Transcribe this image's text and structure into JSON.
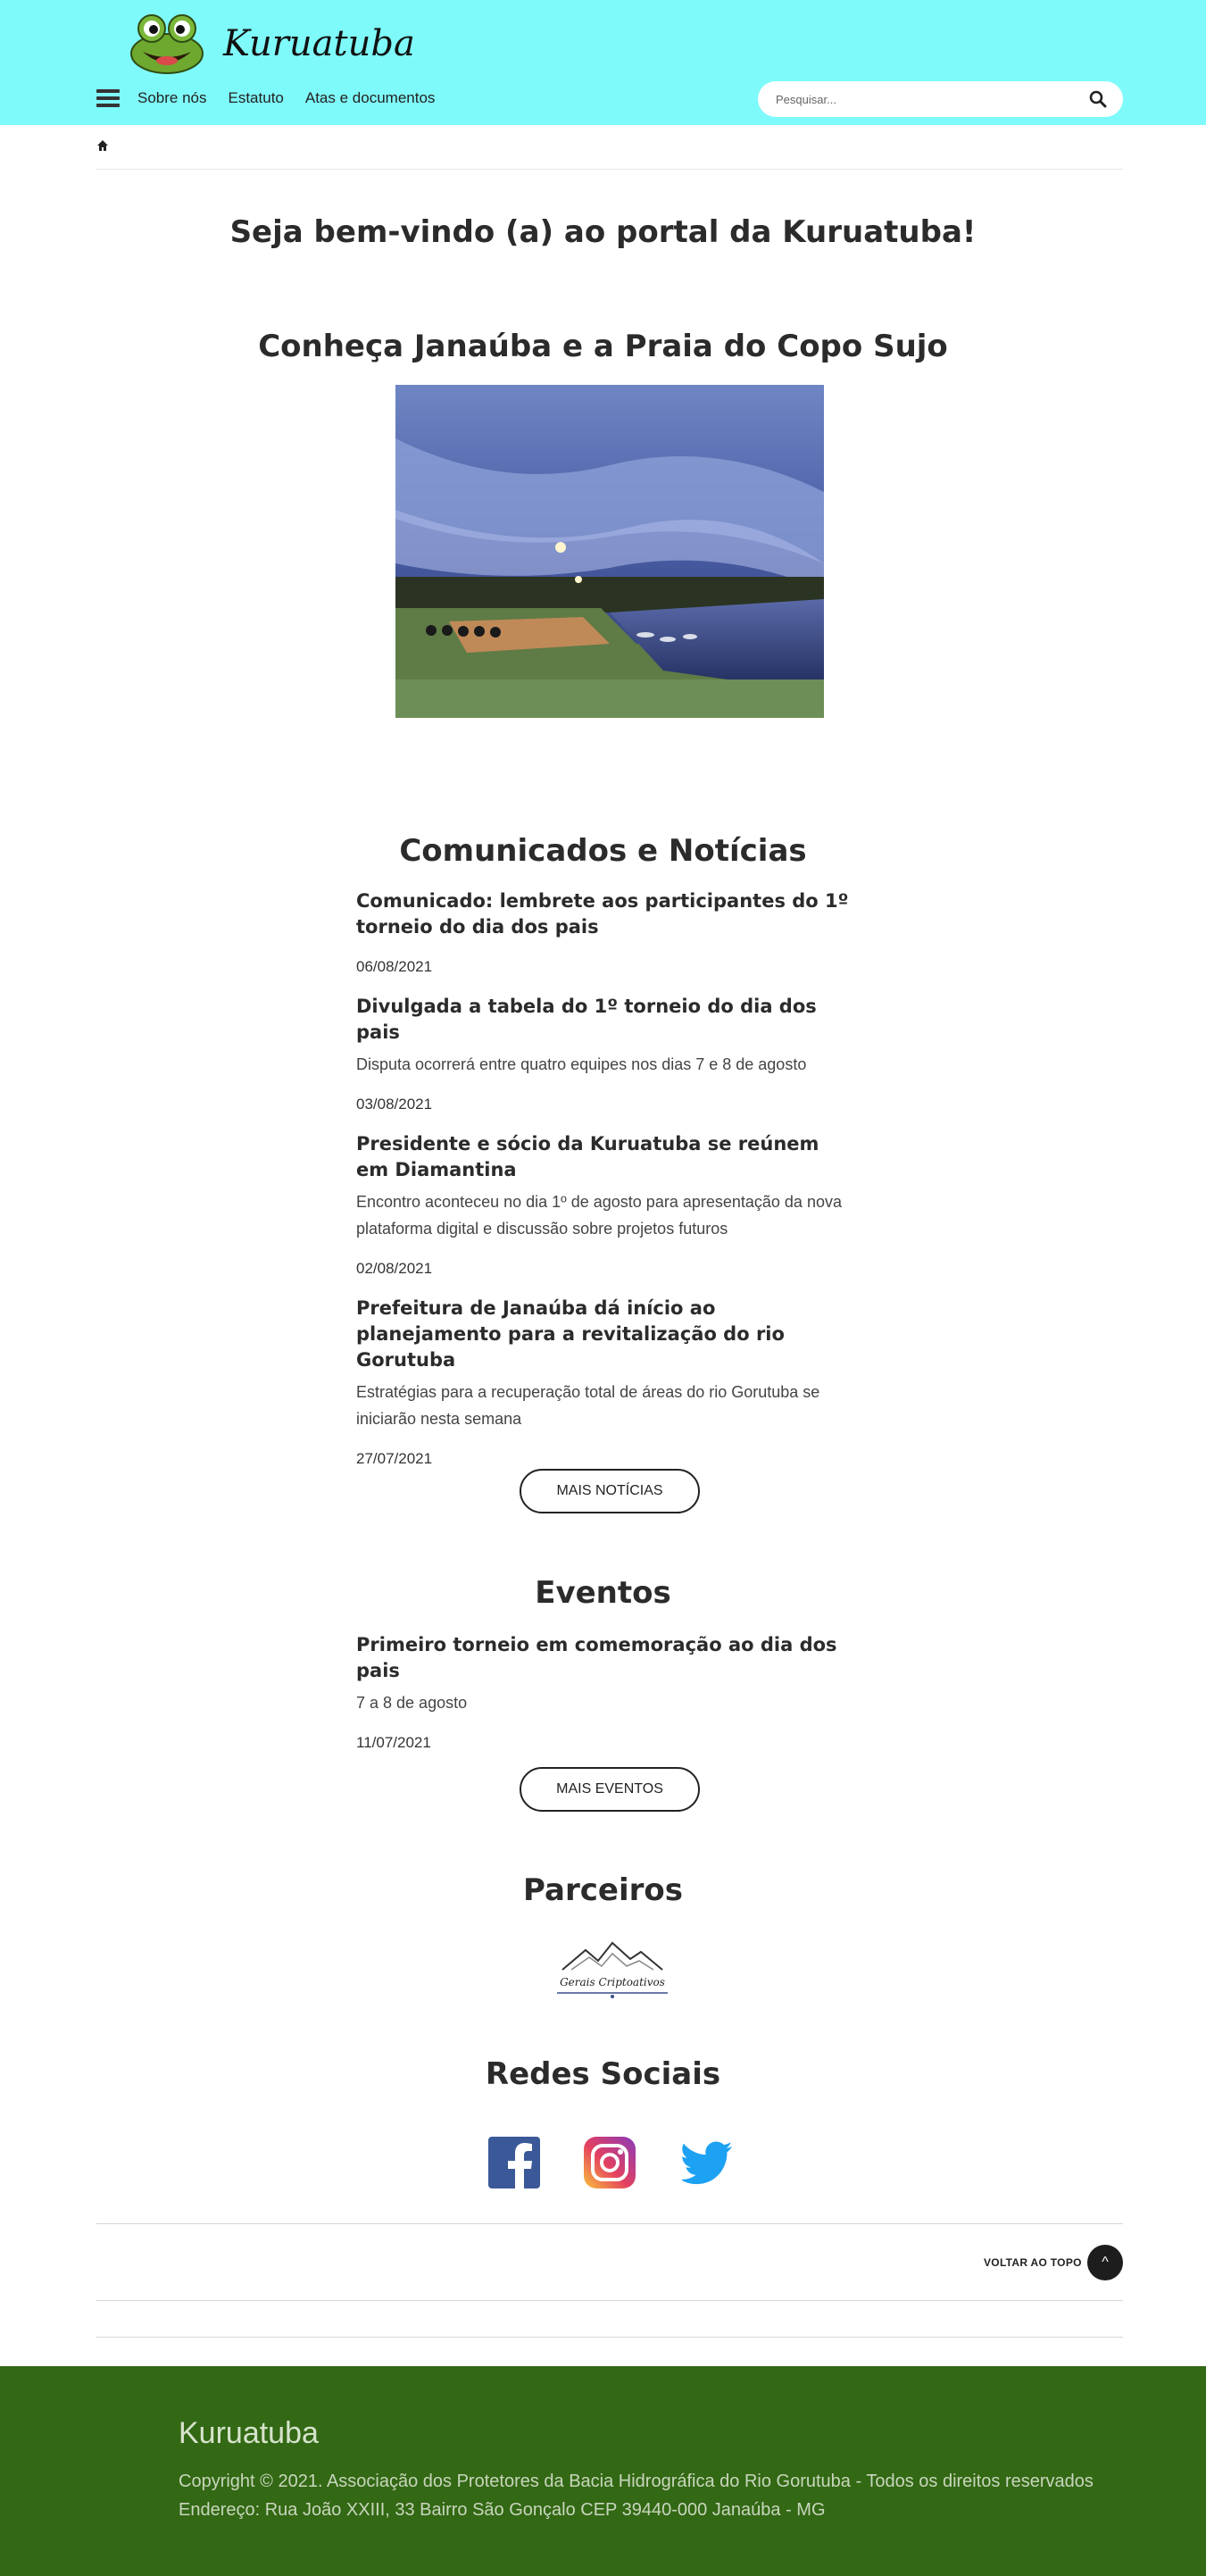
{
  "header": {
    "brand": "Kuruatuba",
    "nav": [
      "Sobre nós",
      "Estatuto",
      "Atas e documentos"
    ],
    "search_placeholder": "Pesquisar..."
  },
  "welcome_title": "Seja bem-vindo (a) ao portal da Kuruatuba!",
  "feature_title": "Conheça Janaúba e a Praia do Copo Sujo",
  "news": {
    "title": "Comunicados e Notícias",
    "items": [
      {
        "title": "Comunicado: lembrete aos participantes do 1º torneio do dia dos pais",
        "subtitle": "",
        "date": "06/08/2021"
      },
      {
        "title": "Divulgada a tabela do 1º torneio do dia dos pais",
        "subtitle": "Disputa ocorrerá entre quatro equipes nos dias 7 e 8 de agosto",
        "date": "03/08/2021"
      },
      {
        "title": "Presidente e sócio da Kuruatuba se reúnem em Diamantina",
        "subtitle": "Encontro aconteceu no dia 1º de agosto para apresentação da nova plataforma digital e discussão sobre projetos futuros",
        "date": "02/08/2021"
      },
      {
        "title": "Prefeitura de Janaúba dá início ao planejamento para a revitalização do rio Gorutuba",
        "subtitle": "Estratégias para a recuperação total de áreas do rio Gorutuba se iniciarão nesta semana",
        "date": "27/07/2021"
      }
    ],
    "more_label": "MAIS NOTÍCIAS"
  },
  "events": {
    "title": "Eventos",
    "items": [
      {
        "title": "Primeiro torneio em comemoração ao dia dos pais",
        "subtitle": "7 a 8 de agosto",
        "date": "11/07/2021"
      }
    ],
    "more_label": "MAIS EVENTOS"
  },
  "partners": {
    "title": "Parceiros",
    "logo_text": "Gerais Criptoativos"
  },
  "social": {
    "title": "Redes Sociais",
    "icons": [
      "facebook-icon",
      "instagram-icon",
      "twitter-icon"
    ]
  },
  "back_to_top": "VOLTAR AO TOPO",
  "footer": {
    "brand": "Kuruatuba",
    "copyright": "Copyright © 2021. Associação dos Protetores da Bacia Hidrográfica do Rio Gorutuba - Todos os direitos reservados",
    "address": "Endereço: Rua João XXIII, 33 Bairro São Gonçalo CEP 39440-000 Janaúba - MG"
  },
  "colors": {
    "header_bg": "#7ffafa",
    "footer_bg": "#336814"
  }
}
